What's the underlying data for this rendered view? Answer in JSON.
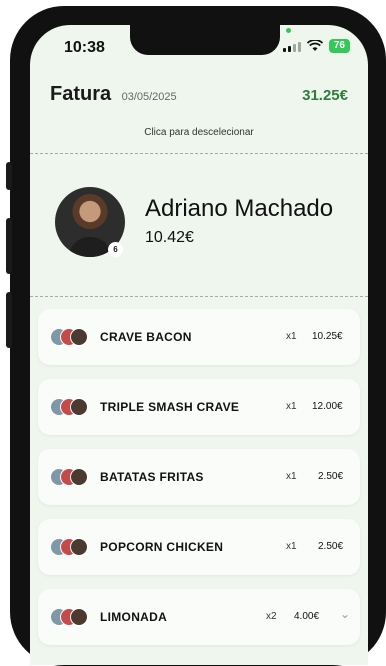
{
  "status_bar": {
    "time": "10:38",
    "battery": "76"
  },
  "header": {
    "title": "Fatura",
    "date": "03/05/2025",
    "total": "31.25€"
  },
  "hint": "Clica para descelecionar",
  "selected_person": {
    "name": "Adriano Machado",
    "amount": "10.42€",
    "badge_count": "6"
  },
  "items": [
    {
      "name": "CRAVE BACON",
      "qty": "x1",
      "price": "10.25€",
      "expandable": false
    },
    {
      "name": "TRIPLE SMASH CRAVE",
      "qty": "x1",
      "price": "12.00€",
      "expandable": false
    },
    {
      "name": "BATATAS FRITAS",
      "qty": "x1",
      "price": "2.50€",
      "expandable": false
    },
    {
      "name": "POPCORN CHICKEN",
      "qty": "x1",
      "price": "2.50€",
      "expandable": false
    },
    {
      "name": "LIMONADA",
      "qty": "x2",
      "price": "4.00€",
      "expandable": true
    }
  ],
  "colors": {
    "accent": "#2e7d3a",
    "background": "#eef6ee",
    "battery": "#34c759"
  },
  "icons": {
    "chevron": "chevron-down-icon",
    "wifi": "wifi-icon",
    "signal": "signal-icon"
  }
}
